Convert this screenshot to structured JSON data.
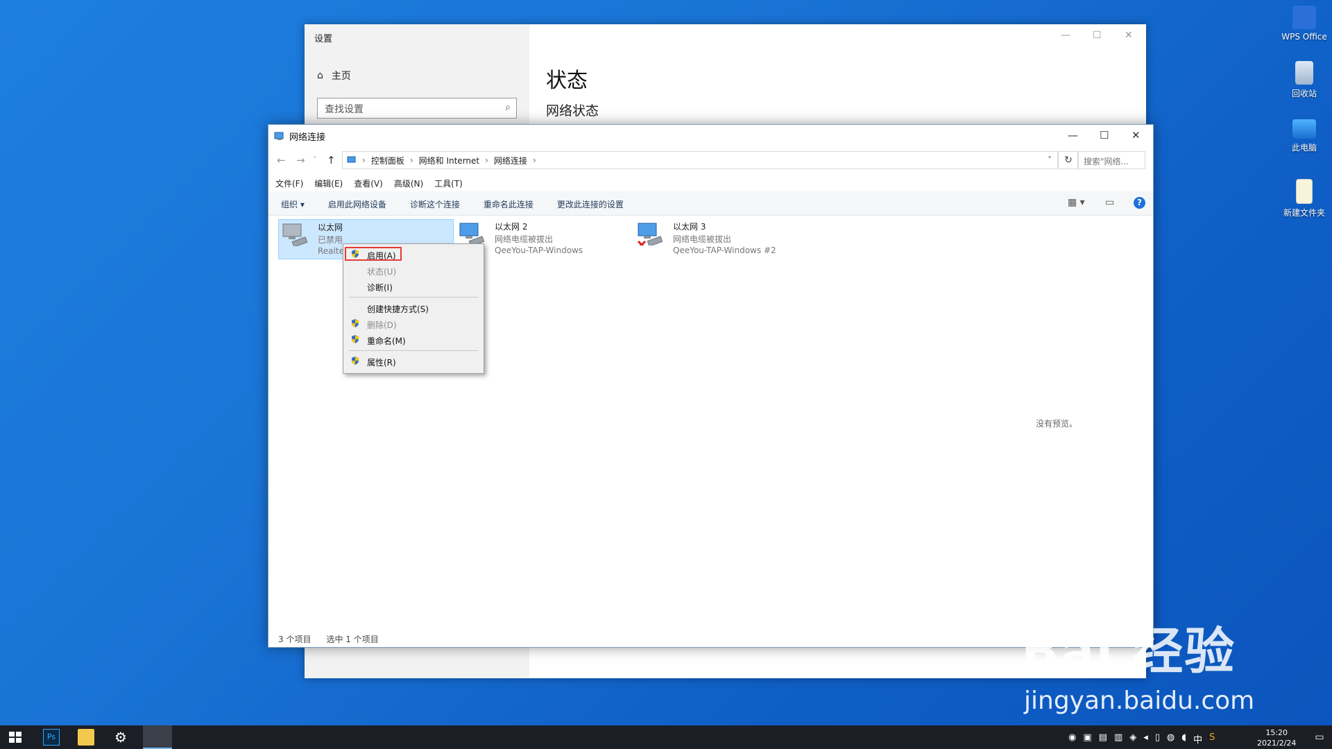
{
  "desktop": {
    "icons": [
      {
        "label": "WPS Office"
      },
      {
        "label": "回收站"
      },
      {
        "label": "此电脑"
      },
      {
        "label": "新建文件夹"
      }
    ]
  },
  "settings_window": {
    "title": "设置",
    "home_label": "主页",
    "search_placeholder": "查找设置",
    "heading": "状态",
    "subheading": "网络状态"
  },
  "network_window": {
    "title": "网络连接",
    "breadcrumb": [
      "控制面板",
      "网络和 Internet",
      "网络连接"
    ],
    "search_placeholder": "搜索\"网络...",
    "menu": [
      "文件(F)",
      "编辑(E)",
      "查看(V)",
      "高级(N)",
      "工具(T)"
    ],
    "commands": [
      "组织 ▾",
      "启用此网络设备",
      "诊断这个连接",
      "重命名此连接",
      "更改此连接的设置"
    ],
    "items": [
      {
        "name": "以太网",
        "status": "已禁用",
        "device": "Realte"
      },
      {
        "name": "以太网 2",
        "status": "网络电缆被拔出",
        "device": "QeeYou-TAP-Windows"
      },
      {
        "name": "以太网 3",
        "status": "网络电缆被拔出",
        "device": "QeeYou-TAP-Windows #2"
      }
    ],
    "no_preview": "没有预览。",
    "status_count": "3 个项目",
    "status_selected": "选中 1 个项目"
  },
  "context_menu": {
    "items": [
      {
        "label": "启用(A)",
        "disabled": false,
        "shield": true
      },
      {
        "label": "状态(U)",
        "disabled": true,
        "shield": false
      },
      {
        "label": "诊断(I)",
        "disabled": false,
        "shield": false
      },
      {
        "label": "创建快捷方式(S)",
        "disabled": false,
        "shield": false
      },
      {
        "label": "删除(D)",
        "disabled": true,
        "shield": true
      },
      {
        "label": "重命名(M)",
        "disabled": false,
        "shield": true
      },
      {
        "label": "属性(R)",
        "disabled": false,
        "shield": true
      }
    ]
  },
  "taskbar": {
    "ime": "中",
    "time": "15:20",
    "date": "2021/2/24"
  },
  "watermark": {
    "brand": "Bai 经验",
    "url": "jingyan.baidu.com"
  },
  "colors": {
    "accent": "#1e72d8",
    "selection": "#cce8ff",
    "highlight_box": "#e53935"
  }
}
